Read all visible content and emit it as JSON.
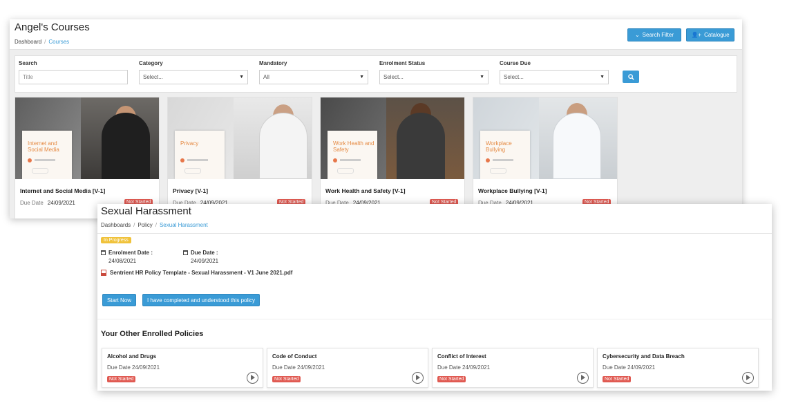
{
  "courses_page": {
    "title": "Angel's Courses",
    "breadcrumb": [
      "Dashboard",
      "Courses"
    ],
    "buttons": {
      "search_filter": "Search Filter",
      "catalogue": "Catalogue"
    },
    "filters": {
      "search": {
        "label": "Search",
        "placeholder": "Title"
      },
      "category": {
        "label": "Category",
        "value": "Select..."
      },
      "mandatory": {
        "label": "Mandatory",
        "value": "All"
      },
      "enrolment_status": {
        "label": "Enrolment Status",
        "value": "Select..."
      },
      "course_due": {
        "label": "Course Due",
        "value": "Select..."
      }
    },
    "due_label": "Due Date",
    "courses": [
      {
        "title": "Internet and Social Media [V-1]",
        "image_title": "Internet and Social Media",
        "due": "24/09/2021",
        "status": "Not Started"
      },
      {
        "title": "Privacy [V-1]",
        "image_title": "Privacy",
        "due": "24/09/2021",
        "status": "Not Started"
      },
      {
        "title": "Work Health and Safety [V-1]",
        "image_title": "Work Health and Safety",
        "due": "24/09/2021",
        "status": "Not Started"
      },
      {
        "title": "Workplace Bullying [V-1]",
        "image_title": "Workplace Bullying",
        "due": "24/09/2021",
        "status": "Not Started"
      }
    ]
  },
  "policy_page": {
    "title": "Sexual Harassment",
    "breadcrumb": [
      "Dashboards",
      "Policy",
      "Sexual Harassment"
    ],
    "status": "In Progress",
    "enrolment_label": "Enrolment Date :",
    "enrolment_date": "24/08/2021",
    "due_label": "Due Date :",
    "due_date": "24/09/2021",
    "file": "Sentrient HR Policy Template - Sexual Harassment - V1 June 2021.pdf",
    "buttons": {
      "start": "Start Now",
      "complete": "I have completed and understood this policy"
    },
    "other_title": "Your Other Enrolled Policies",
    "other_policies": [
      {
        "title": "Alcohol and Drugs",
        "due": "Due Date 24/09/2021",
        "status": "Not Started"
      },
      {
        "title": "Code of Conduct",
        "due": "Due Date 24/09/2021",
        "status": "Not Started"
      },
      {
        "title": "Conflict of Interest",
        "due": "Due Date 24/09/2021",
        "status": "Not Started"
      },
      {
        "title": "Cybersecurity and Data Breach",
        "due": "Due Date 24/09/2021",
        "status": "Not Started"
      }
    ]
  },
  "colors": {
    "accent": "#3a9bd6",
    "danger": "#e05a52",
    "warning": "#f0c23a"
  }
}
